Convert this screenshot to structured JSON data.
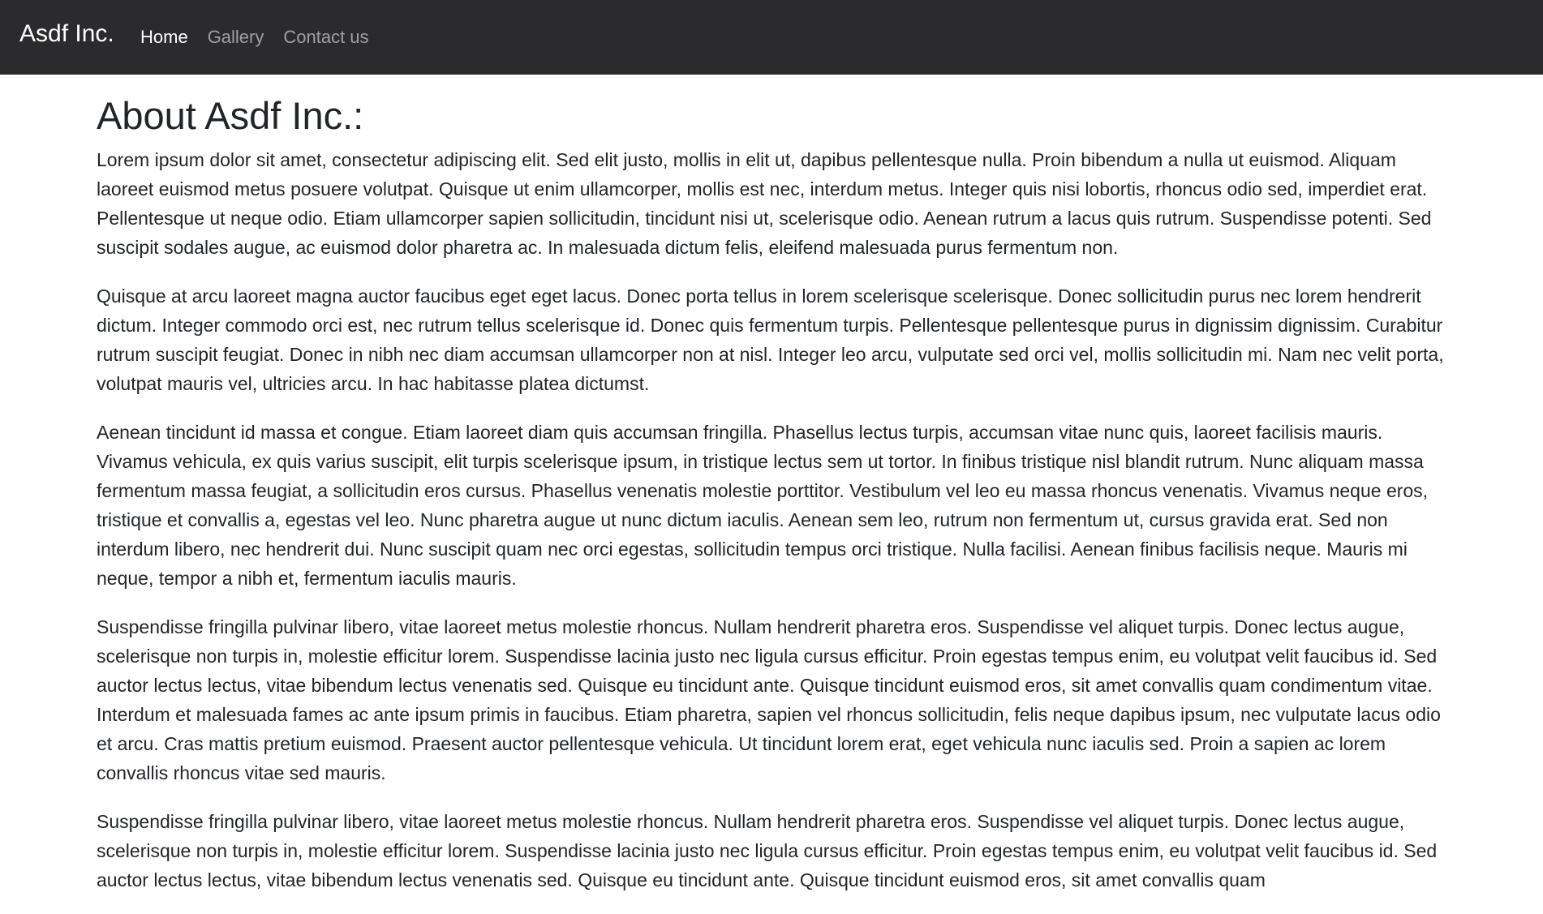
{
  "navbar": {
    "brand": "Asdf Inc.",
    "links": [
      {
        "label": "Home",
        "active": true
      },
      {
        "label": "Gallery",
        "active": false
      },
      {
        "label": "Contact us",
        "active": false
      }
    ],
    "background": "#2b2b2d"
  },
  "main": {
    "title": "About Asdf Inc.:",
    "paragraphs": [
      "Lorem ipsum dolor sit amet, consectetur adipiscing elit. Sed elit justo, mollis in elit ut, dapibus pellentesque nulla. Proin bibendum a nulla ut euismod. Aliquam laoreet euismod metus posuere volutpat. Quisque ut enim ullamcorper, mollis est nec, interdum metus. Integer quis nisi lobortis, rhoncus odio sed, imperdiet erat. Pellentesque ut neque odio. Etiam ullamcorper sapien sollicitudin, tincidunt nisi ut, scelerisque odio. Aenean rutrum a lacus quis rutrum. Suspendisse potenti. Sed suscipit sodales augue, ac euismod dolor pharetra ac. In malesuada dictum felis, eleifend malesuada purus fermentum non.",
      "Quisque at arcu laoreet magna auctor faucibus eget eget lacus. Donec porta tellus in lorem scelerisque scelerisque. Donec sollicitudin purus nec lorem hendrerit dictum. Integer commodo orci est, nec rutrum tellus scelerisque id. Donec quis fermentum turpis. Pellentesque pellentesque purus in dignissim dignissim. Curabitur rutrum suscipit feugiat. Donec in nibh nec diam accumsan ullamcorper non at nisl. Integer leo arcu, vulputate sed orci vel, mollis sollicitudin mi. Nam nec velit porta, volutpat mauris vel, ultricies arcu. In hac habitasse platea dictumst.",
      "Aenean tincidunt id massa et congue. Etiam laoreet diam quis accumsan fringilla. Phasellus lectus turpis, accumsan vitae nunc quis, laoreet facilisis mauris. Vivamus vehicula, ex quis varius suscipit, elit turpis scelerisque ipsum, in tristique lectus sem ut tortor. In finibus tristique nisl blandit rutrum. Nunc aliquam massa fermentum massa feugiat, a sollicitudin eros cursus. Phasellus venenatis molestie porttitor. Vestibulum vel leo eu massa rhoncus venenatis. Vivamus neque eros, tristique et convallis a, egestas vel leo. Nunc pharetra augue ut nunc dictum iaculis. Aenean sem leo, rutrum non fermentum ut, cursus gravida erat. Sed non interdum libero, nec hendrerit dui. Nunc suscipit quam nec orci egestas, sollicitudin tempus orci tristique. Nulla facilisi. Aenean finibus facilisis neque. Mauris mi neque, tempor a nibh et, fermentum iaculis mauris.",
      "Suspendisse fringilla pulvinar libero, vitae laoreet metus molestie rhoncus. Nullam hendrerit pharetra eros. Suspendisse vel aliquet turpis. Donec lectus augue, scelerisque non turpis in, molestie efficitur lorem. Suspendisse lacinia justo nec ligula cursus efficitur. Proin egestas tempus enim, eu volutpat velit faucibus id. Sed auctor lectus lectus, vitae bibendum lectus venenatis sed. Quisque eu tincidunt ante. Quisque tincidunt euismod eros, sit amet convallis quam condimentum vitae. Interdum et malesuada fames ac ante ipsum primis in faucibus. Etiam pharetra, sapien vel rhoncus sollicitudin, felis neque dapibus ipsum, nec vulputate lacus odio et arcu. Cras mattis pretium euismod. Praesent auctor pellentesque vehicula. Ut tincidunt lorem erat, eget vehicula nunc iaculis sed. Proin a sapien ac lorem convallis rhoncus vitae sed mauris.",
      "Suspendisse fringilla pulvinar libero, vitae laoreet metus molestie rhoncus. Nullam hendrerit pharetra eros. Suspendisse vel aliquet turpis. Donec lectus augue, scelerisque non turpis in, molestie efficitur lorem. Suspendisse lacinia justo nec ligula cursus efficitur. Proin egestas tempus enim, eu volutpat velit faucibus id. Sed auctor lectus lectus, vitae bibendum lectus venenatis sed. Quisque eu tincidunt ante. Quisque tincidunt euismod eros, sit amet convallis quam"
    ]
  }
}
